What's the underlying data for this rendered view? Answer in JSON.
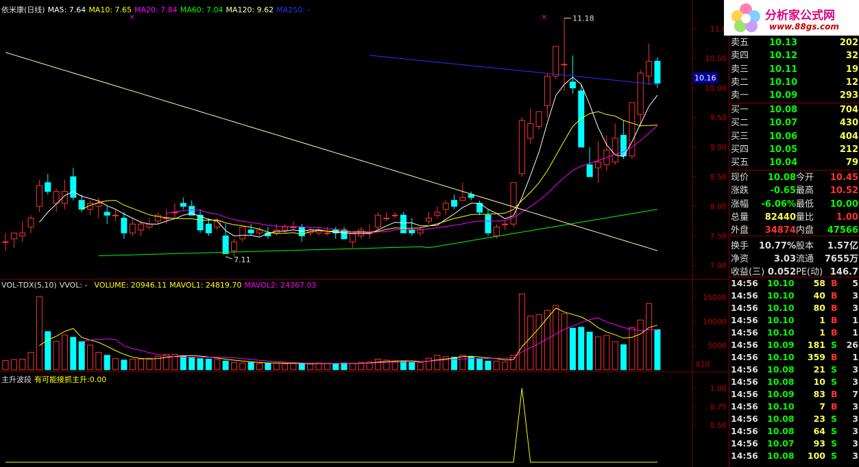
{
  "header": {
    "stock_name": "依米康(日线)",
    "ma5": "MA5: 7.64",
    "ma10": "MA10: 7.65",
    "ma20": "MA20: 7.84",
    "ma60": "MA60: 7.04",
    "ma120": "MA120: 9.62",
    "ma250": "MA250: -"
  },
  "price_axis": [
    "11.0",
    "10.50",
    "10.00",
    "9.50",
    "9.00",
    "8.50",
    "8.00",
    "7.50",
    "7.00"
  ],
  "price_tag": "10.16",
  "high_label": "11.18",
  "low_label": "7.11",
  "vol_header": {
    "name": "VOL-TDX(5,10)",
    "vvol": "VVOL: -",
    "volume": "VOLUME: 20946.11",
    "mavol1": "MAVOL1: 24819.70",
    "mavol2": "MAVOL2: 24367.03"
  },
  "vol_axis": [
    "15000",
    "10000",
    "5000"
  ],
  "vol_unit": "X10",
  "ind_header": {
    "name": "主升波段",
    "desc": "有可能接抓主升:",
    "value": "0.00"
  },
  "ind_axis": [
    "1.00",
    "0.75",
    "0.50"
  ],
  "logo": {
    "brand": "分析家公式网",
    "url": "www.88gs.com"
  },
  "asks": [
    {
      "label": "卖五",
      "price": "10.13",
      "vol": "202"
    },
    {
      "label": "卖四",
      "price": "10.12",
      "vol": "32"
    },
    {
      "label": "卖三",
      "price": "10.11",
      "vol": "19"
    },
    {
      "label": "卖二",
      "price": "10.10",
      "vol": "12"
    },
    {
      "label": "卖一",
      "price": "10.09",
      "vol": "293"
    }
  ],
  "bids": [
    {
      "label": "买一",
      "price": "10.08",
      "vol": "704"
    },
    {
      "label": "买二",
      "price": "10.07",
      "vol": "430"
    },
    {
      "label": "买三",
      "price": "10.06",
      "vol": "404"
    },
    {
      "label": "买四",
      "price": "10.05",
      "vol": "212"
    },
    {
      "label": "买五",
      "price": "10.04",
      "vol": "79"
    }
  ],
  "quote": {
    "xianjia_l": "现价",
    "xianjia": "10.08",
    "jinkai_l": "今开",
    "jinkai": "10.45",
    "zhangdie_l": "涨跌",
    "zhangdie": "-0.65",
    "zuigao_l": "最高",
    "zuigao": "10.52",
    "zhangfu_l": "涨幅",
    "zhangfu": "-6.06%",
    "zuidi_l": "最低",
    "zuidi": "10.00",
    "zongliang_l": "总量",
    "zongliang": "82440",
    "liangbi_l": "量比",
    "liangbi": "1.00",
    "waipan_l": "外盘",
    "waipan": "34874",
    "neipan_l": "内盘",
    "neipan": "47566",
    "huanshou_l": "换手",
    "huanshou": "10.77%",
    "guben_l": "股本",
    "guben": "1.57亿",
    "jingzi_l": "净资",
    "jingzi": "3.03",
    "liutong_l": "流通",
    "liutong": "7655万",
    "shouyi_l": "收益(三)",
    "shouyi": "0.052",
    "pe_l": "PE(动)",
    "pe": "146.7"
  },
  "ticks": [
    {
      "time": "14:56",
      "price": "10.10",
      "vol": "58",
      "side": "B",
      "n": "5"
    },
    {
      "time": "14:56",
      "price": "10.10",
      "vol": "40",
      "side": "B",
      "n": "3"
    },
    {
      "time": "14:56",
      "price": "10.10",
      "vol": "80",
      "side": "B",
      "n": "3"
    },
    {
      "time": "14:56",
      "price": "10.10",
      "vol": "1",
      "side": "B",
      "n": "1"
    },
    {
      "time": "14:56",
      "price": "10.10",
      "vol": "1",
      "side": "B",
      "n": "1"
    },
    {
      "time": "14:56",
      "price": "10.09",
      "vol": "181",
      "side": "S",
      "n": "26"
    },
    {
      "time": "14:56",
      "price": "10.10",
      "vol": "359",
      "side": "B",
      "n": "1"
    },
    {
      "time": "14:56",
      "price": "10.08",
      "vol": "21",
      "side": "S",
      "n": "3"
    },
    {
      "time": "14:56",
      "price": "10.08",
      "vol": "10",
      "side": "S",
      "n": "3"
    },
    {
      "time": "14:56",
      "price": "10.09",
      "vol": "83",
      "side": "B",
      "n": "7"
    },
    {
      "time": "14:56",
      "price": "10.10",
      "vol": "7",
      "side": "B",
      "n": "3"
    },
    {
      "time": "14:56",
      "price": "10.08",
      "vol": "23",
      "side": "S",
      "n": "3"
    },
    {
      "time": "14:56",
      "price": "10.08",
      "vol": "64",
      "side": "S",
      "n": "3"
    },
    {
      "time": "14:56",
      "price": "10.07",
      "vol": "93",
      "side": "S",
      "n": "3"
    },
    {
      "time": "14:56",
      "price": "10.08",
      "vol": "100",
      "side": "S",
      "n": "3"
    }
  ],
  "colors": {
    "up": "#ff3232",
    "down": "#00ffff",
    "ma5": "#ffffff",
    "ma10": "#ffff00",
    "ma20": "#ff00ff",
    "ma60": "#00ff00",
    "ma120": "#ffffb0",
    "ma250": "#3030ff",
    "grid": "#800000",
    "ind": "#ffff00"
  },
  "chart_data": {
    "type": "candlestick",
    "candles": [
      [
        7.4,
        7.55,
        7.25,
        7.4
      ],
      [
        7.45,
        7.55,
        7.3,
        7.55
      ],
      [
        7.5,
        7.75,
        7.4,
        7.55
      ],
      [
        7.65,
        7.85,
        7.55,
        7.8
      ],
      [
        8.0,
        8.45,
        7.9,
        8.35
      ],
      [
        8.4,
        8.55,
        8.2,
        8.25
      ],
      [
        8.05,
        8.3,
        7.9,
        8.25
      ],
      [
        8.05,
        8.45,
        7.95,
        8.25
      ],
      [
        8.5,
        8.65,
        8.1,
        8.15
      ],
      [
        8.1,
        8.2,
        7.9,
        7.95
      ],
      [
        7.95,
        8.1,
        7.85,
        8.05
      ],
      [
        8.0,
        8.15,
        7.8,
        8.05
      ],
      [
        7.9,
        8.0,
        7.7,
        7.85
      ],
      [
        7.85,
        7.95,
        7.75,
        7.85
      ],
      [
        7.8,
        7.9,
        7.45,
        7.55
      ],
      [
        7.55,
        7.8,
        7.5,
        7.7
      ],
      [
        7.6,
        7.75,
        7.5,
        7.7
      ],
      [
        7.65,
        7.8,
        7.6,
        7.7
      ],
      [
        7.75,
        7.9,
        7.7,
        7.85
      ],
      [
        7.8,
        7.95,
        7.7,
        7.8
      ],
      [
        7.9,
        8.05,
        7.8,
        7.9
      ],
      [
        8.05,
        8.15,
        7.95,
        8.0
      ],
      [
        8.0,
        8.1,
        7.9,
        7.85
      ],
      [
        7.85,
        7.95,
        7.55,
        7.6
      ],
      [
        7.7,
        7.8,
        7.5,
        7.55
      ],
      [
        7.65,
        7.8,
        7.6,
        7.75
      ],
      [
        7.5,
        7.7,
        7.2,
        7.2
      ],
      [
        7.25,
        7.45,
        7.15,
        7.4
      ],
      [
        7.45,
        7.65,
        7.4,
        7.65
      ],
      [
        7.6,
        7.7,
        7.5,
        7.55
      ],
      [
        7.55,
        7.65,
        7.5,
        7.6
      ],
      [
        7.55,
        7.65,
        7.45,
        7.5
      ],
      [
        7.55,
        7.7,
        7.5,
        7.6
      ],
      [
        7.6,
        7.7,
        7.55,
        7.65
      ],
      [
        7.65,
        7.75,
        7.6,
        7.65
      ],
      [
        7.65,
        7.7,
        7.4,
        7.5
      ],
      [
        7.55,
        7.65,
        7.5,
        7.6
      ],
      [
        7.55,
        7.65,
        7.5,
        7.6
      ],
      [
        7.55,
        7.65,
        7.5,
        7.55
      ],
      [
        7.6,
        7.65,
        7.45,
        7.55
      ],
      [
        7.6,
        7.65,
        7.45,
        7.45
      ],
      [
        7.4,
        7.55,
        7.3,
        7.55
      ],
      [
        7.5,
        7.65,
        7.45,
        7.6
      ],
      [
        7.55,
        7.7,
        7.45,
        7.55
      ],
      [
        7.65,
        7.9,
        7.6,
        7.85
      ],
      [
        7.8,
        7.9,
        7.75,
        7.8
      ],
      [
        7.85,
        7.9,
        7.8,
        7.85
      ],
      [
        7.85,
        7.9,
        7.55,
        7.55
      ],
      [
        7.6,
        7.8,
        7.5,
        7.55
      ],
      [
        7.55,
        7.65,
        7.5,
        7.6
      ],
      [
        7.75,
        7.9,
        7.7,
        7.8
      ],
      [
        7.85,
        8.0,
        7.8,
        7.9
      ],
      [
        7.95,
        8.1,
        7.85,
        8.05
      ],
      [
        8.1,
        8.2,
        7.95,
        8.0
      ],
      [
        8.1,
        8.4,
        8.1,
        8.15
      ],
      [
        8.2,
        8.25,
        8.1,
        8.15
      ],
      [
        8.05,
        8.1,
        7.85,
        7.9
      ],
      [
        7.85,
        7.95,
        7.5,
        7.55
      ],
      [
        7.5,
        7.7,
        7.45,
        7.65
      ],
      [
        7.7,
        7.75,
        7.6,
        7.7
      ],
      [
        7.7,
        8.4,
        7.65,
        8.4
      ],
      [
        8.55,
        9.5,
        8.5,
        9.45
      ],
      [
        9.15,
        9.65,
        9.05,
        9.4
      ],
      [
        9.35,
        9.6,
        9.3,
        9.6
      ],
      [
        9.7,
        10.25,
        9.5,
        10.2
      ],
      [
        10.2,
        10.7,
        10.15,
        10.7
      ],
      [
        10.4,
        11.18,
        9.95,
        10.4
      ],
      [
        10.1,
        10.55,
        9.9,
        10.0
      ],
      [
        9.95,
        10.05,
        9.05,
        9.0
      ],
      [
        8.7,
        9.0,
        8.55,
        8.5
      ],
      [
        8.65,
        9.1,
        8.4,
        8.75
      ],
      [
        8.7,
        9.2,
        8.6,
        8.95
      ],
      [
        8.75,
        9.4,
        8.7,
        9.15
      ],
      [
        9.2,
        9.45,
        8.8,
        8.85
      ],
      [
        8.85,
        9.75,
        8.8,
        9.75
      ],
      [
        9.55,
        10.3,
        9.35,
        10.25
      ],
      [
        10.2,
        10.75,
        10.05,
        10.45
      ],
      [
        10.45,
        10.52,
        10.0,
        10.08
      ]
    ],
    "volume": [
      1900,
      2100,
      2200,
      3600,
      15100,
      7900,
      5900,
      7200,
      6700,
      5800,
      5100,
      3600,
      3000,
      2300,
      2000,
      2200,
      2200,
      2400,
      2800,
      3200,
      3200,
      2900,
      2600,
      2300,
      2200,
      2100,
      1800,
      1500,
      1400,
      1500,
      1300,
      1400,
      1400,
      1200,
      1300,
      1300,
      1200,
      1400,
      1300,
      1200,
      1400,
      1300,
      1500,
      1600,
      2200,
      2000,
      1700,
      1700,
      1600,
      1500,
      2400,
      3000,
      2700,
      2600,
      3000,
      2700,
      2200,
      1800,
      1800,
      1600,
      3000,
      15700,
      11100,
      11400,
      12300,
      13300,
      11600,
      8600,
      8800,
      7800,
      6800,
      7100,
      5800,
      5200,
      8700,
      10300,
      13700,
      8300
    ],
    "ylim_price": [
      6.8,
      11.3
    ],
    "ylim_volume": [
      0,
      17000
    ],
    "indicator": {
      "spike_at_index": 61,
      "value": 1.0,
      "ylim": [
        0,
        1.1
      ]
    }
  }
}
